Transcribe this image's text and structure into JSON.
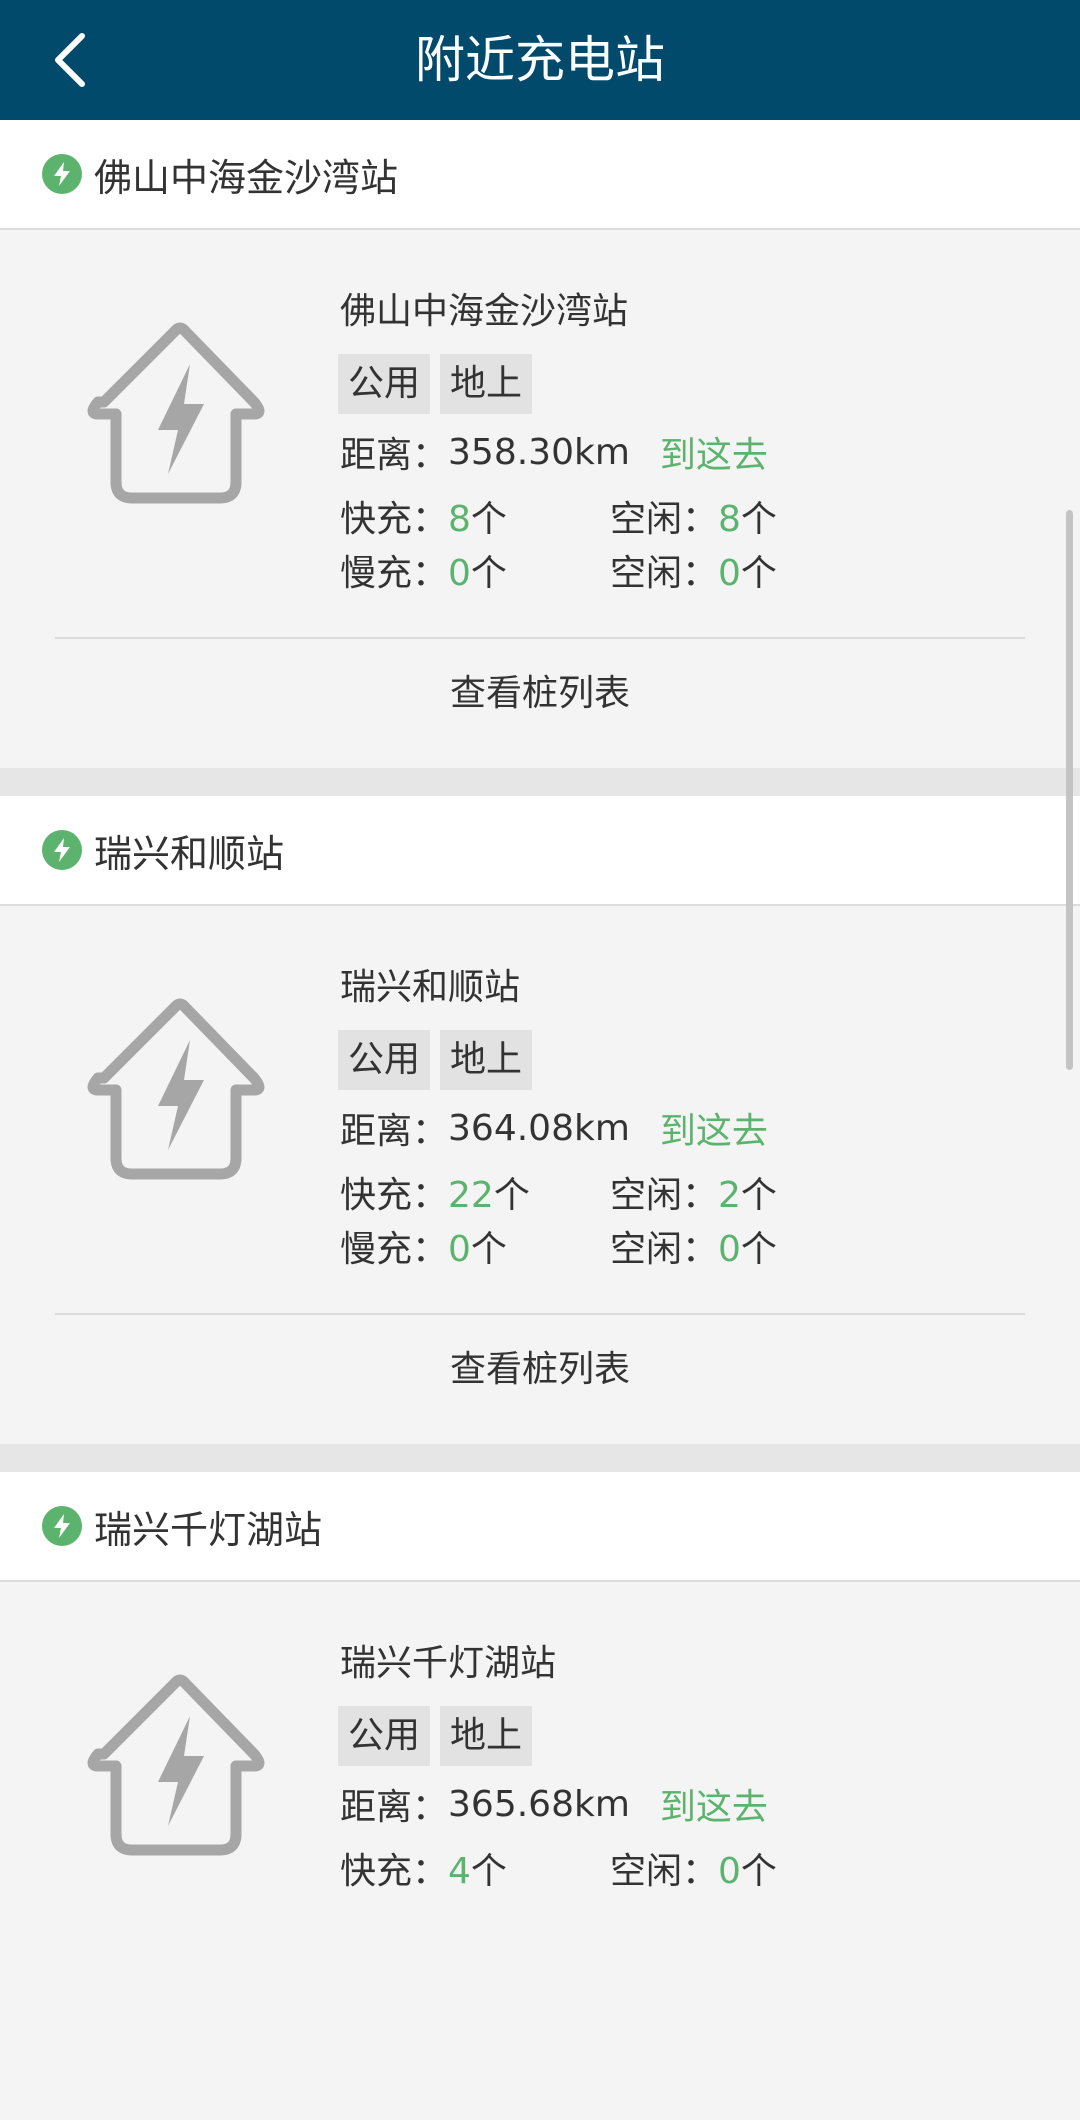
{
  "header": {
    "title": "附近充电站",
    "back_icon": "chevron-left-icon"
  },
  "labels": {
    "distance": "距离：",
    "goto": "到这去",
    "fast": "快充：",
    "slow": "慢充：",
    "idle": "空闲：",
    "unit": "个",
    "view_list": "查看桩列表"
  },
  "colors": {
    "header_bg": "#024a6c",
    "accent_green": "#5cb36e",
    "icon_gray": "#a6a6a6"
  },
  "stations": [
    {
      "name": "佛山中海金沙湾站",
      "tags": [
        "公用",
        "地上"
      ],
      "distance": "358.30km",
      "fast": "8",
      "fast_idle": "8",
      "slow": "0",
      "slow_idle": "0"
    },
    {
      "name": "瑞兴和顺站",
      "tags": [
        "公用",
        "地上"
      ],
      "distance": "364.08km",
      "fast": "22",
      "fast_idle": "2",
      "slow": "0",
      "slow_idle": "0"
    },
    {
      "name": "瑞兴千灯湖站",
      "tags": [
        "公用",
        "地上"
      ],
      "distance": "365.68km",
      "fast": "4",
      "fast_idle": "0"
    }
  ]
}
